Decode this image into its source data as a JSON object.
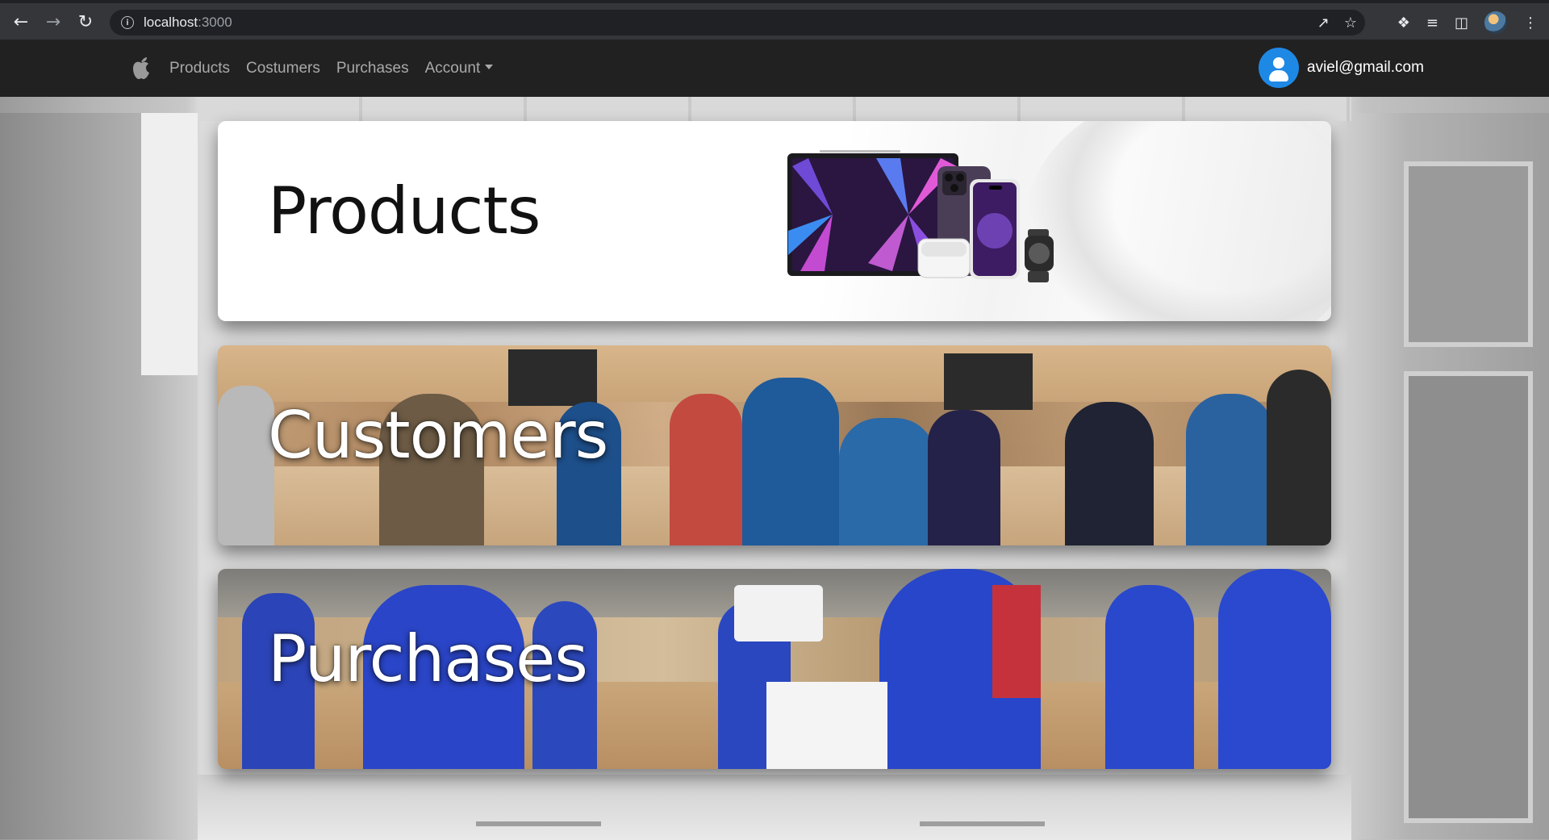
{
  "browser": {
    "url_host": "localhost",
    "url_port": ":3000"
  },
  "navbar": {
    "links": [
      "Products",
      "Costumers",
      "Purchases",
      "Account"
    ],
    "user_email": "aviel@gmail.com"
  },
  "cards": {
    "products_title": "Products",
    "customers_title": "Customers",
    "purchases_title": "Purchases"
  },
  "colors": {
    "navbar_bg": "#212121",
    "chrome_bg": "#35363a",
    "avatar_bg": "#1e88e5",
    "nav_link": "#a9a9a9"
  }
}
